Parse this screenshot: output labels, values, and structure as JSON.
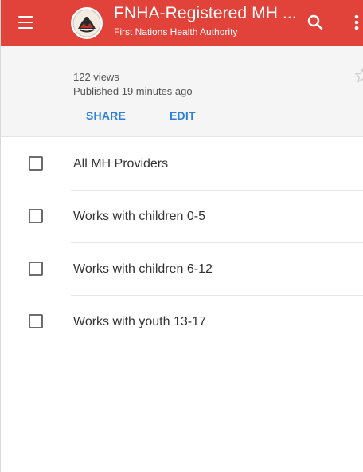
{
  "header": {
    "title": "FNHA-Registered MH ...",
    "subtitle": "First Nations Health Authority",
    "logo_icon": "fnha-logo-icon",
    "bar_color": "#e1433b"
  },
  "info": {
    "views": "122 views",
    "published": "Published 19 minutes ago",
    "share_label": "SHARE",
    "edit_label": "EDIT",
    "accent_color": "#2d80d8"
  },
  "layers": [
    {
      "label": "All MH Providers",
      "checked": false
    },
    {
      "label": "Works with children 0-5",
      "checked": false
    },
    {
      "label": "Works with children 6-12",
      "checked": false
    },
    {
      "label": "Works with youth 13-17",
      "checked": false
    }
  ]
}
